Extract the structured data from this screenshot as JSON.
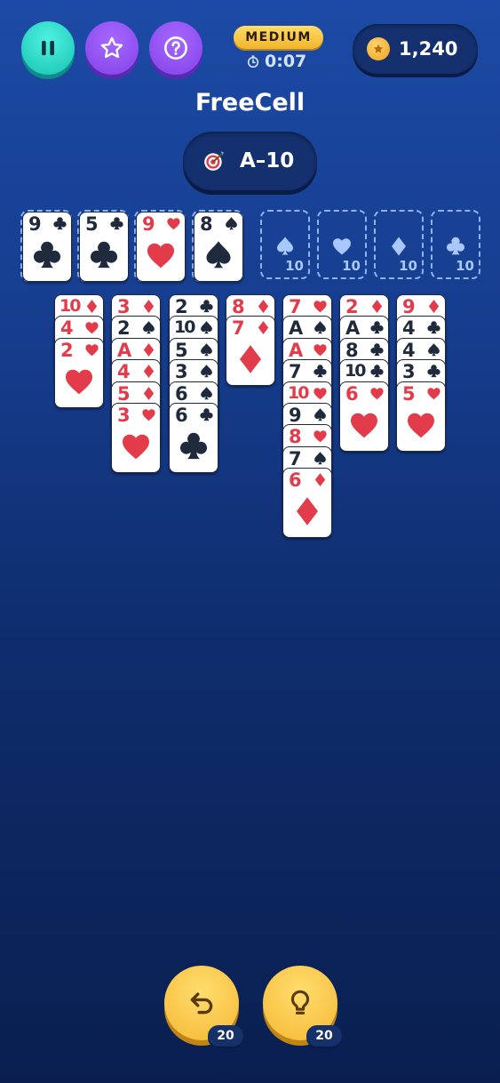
{
  "header": {
    "pause_icon": "pause-icon",
    "star_icon": "star-icon",
    "help_icon": "question-icon",
    "difficulty": "MEDIUM",
    "timer": "0:07",
    "coins": "1,240"
  },
  "title": "FreeCell",
  "goal": "A–10",
  "colors": {
    "red_suit": "#e23b4a",
    "black_suit": "#1f2a3c",
    "teal_button": "#17c2b2",
    "purple_button": "#8242e8",
    "gold_button": "#f6b833"
  },
  "free_cells": [
    {
      "rank": "9",
      "suit": "clubs"
    },
    {
      "rank": "5",
      "suit": "clubs"
    },
    {
      "rank": "9",
      "suit": "hearts"
    },
    {
      "rank": "8",
      "suit": "spades"
    }
  ],
  "foundations": [
    {
      "suit": "spades",
      "count": "10"
    },
    {
      "suit": "hearts",
      "count": "10"
    },
    {
      "suit": "diamonds",
      "count": "10"
    },
    {
      "suit": "clubs",
      "count": "10"
    }
  ],
  "tableau": [
    [
      {
        "rank": "10",
        "suit": "diamonds"
      },
      {
        "rank": "4",
        "suit": "hearts"
      },
      {
        "rank": "2",
        "suit": "hearts"
      }
    ],
    [
      {
        "rank": "3",
        "suit": "diamonds"
      },
      {
        "rank": "2",
        "suit": "spades"
      },
      {
        "rank": "A",
        "suit": "diamonds"
      },
      {
        "rank": "4",
        "suit": "diamonds"
      },
      {
        "rank": "5",
        "suit": "diamonds"
      },
      {
        "rank": "3",
        "suit": "hearts"
      }
    ],
    [
      {
        "rank": "2",
        "suit": "clubs"
      },
      {
        "rank": "10",
        "suit": "spades"
      },
      {
        "rank": "5",
        "suit": "spades"
      },
      {
        "rank": "3",
        "suit": "spades"
      },
      {
        "rank": "6",
        "suit": "spades"
      },
      {
        "rank": "6",
        "suit": "clubs"
      }
    ],
    [
      {
        "rank": "8",
        "suit": "diamonds"
      },
      {
        "rank": "7",
        "suit": "diamonds"
      }
    ],
    [
      {
        "rank": "7",
        "suit": "hearts"
      },
      {
        "rank": "A",
        "suit": "spades"
      },
      {
        "rank": "A",
        "suit": "hearts"
      },
      {
        "rank": "7",
        "suit": "clubs"
      },
      {
        "rank": "10",
        "suit": "hearts"
      },
      {
        "rank": "9",
        "suit": "spades"
      },
      {
        "rank": "8",
        "suit": "hearts"
      },
      {
        "rank": "7",
        "suit": "spades"
      },
      {
        "rank": "6",
        "suit": "diamonds"
      }
    ],
    [
      {
        "rank": "2",
        "suit": "diamonds"
      },
      {
        "rank": "A",
        "suit": "clubs"
      },
      {
        "rank": "8",
        "suit": "clubs"
      },
      {
        "rank": "10",
        "suit": "clubs"
      },
      {
        "rank": "6",
        "suit": "hearts"
      }
    ],
    [
      {
        "rank": "9",
        "suit": "diamonds"
      },
      {
        "rank": "4",
        "suit": "clubs"
      },
      {
        "rank": "4",
        "suit": "spades"
      },
      {
        "rank": "3",
        "suit": "clubs"
      },
      {
        "rank": "5",
        "suit": "hearts"
      }
    ]
  ],
  "footer": {
    "undo_icon": "undo-icon",
    "undo_count": "20",
    "hint_icon": "lightbulb-icon",
    "hint_count": "20"
  }
}
